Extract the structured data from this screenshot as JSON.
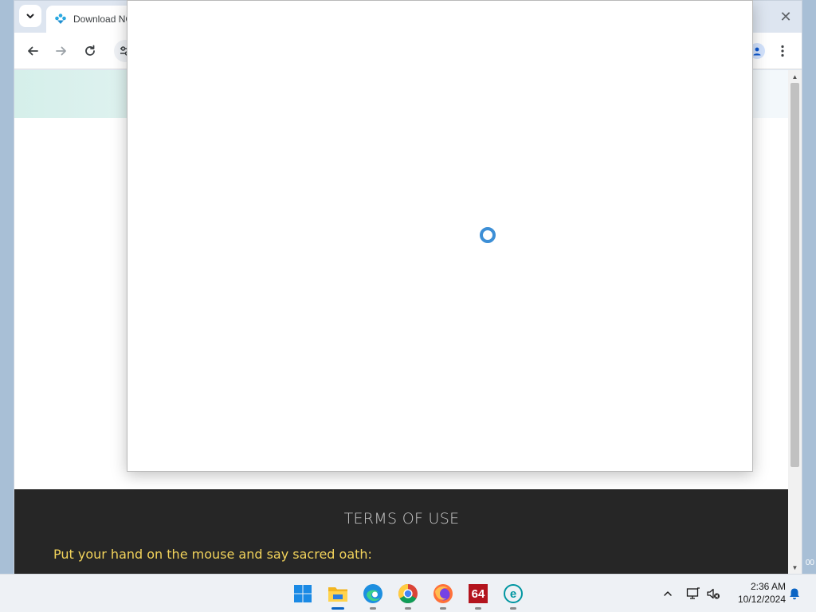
{
  "browser": {
    "tab_title": "Download NC",
    "close_symbol": "✕"
  },
  "page": {
    "footer_title": "TERMS OF USE",
    "oath_text": "Put your hand on the mouse and say sacred oath:"
  },
  "desktop": {
    "edge_text": "00"
  },
  "taskbar": {
    "apps": [
      "start-icon",
      "file-explorer-icon",
      "edge-icon",
      "chrome-icon",
      "firefox-icon",
      "aida64-icon",
      "eset-icon"
    ],
    "app_64_label": "64",
    "eset_label": "e",
    "time": "2:36 AM",
    "date": "10/12/2024"
  },
  "colors": {
    "accent": "#0a64c4",
    "footer_bg": "#262626",
    "oath_text": "#f2d35b",
    "spinner": "#3d8fd6"
  }
}
